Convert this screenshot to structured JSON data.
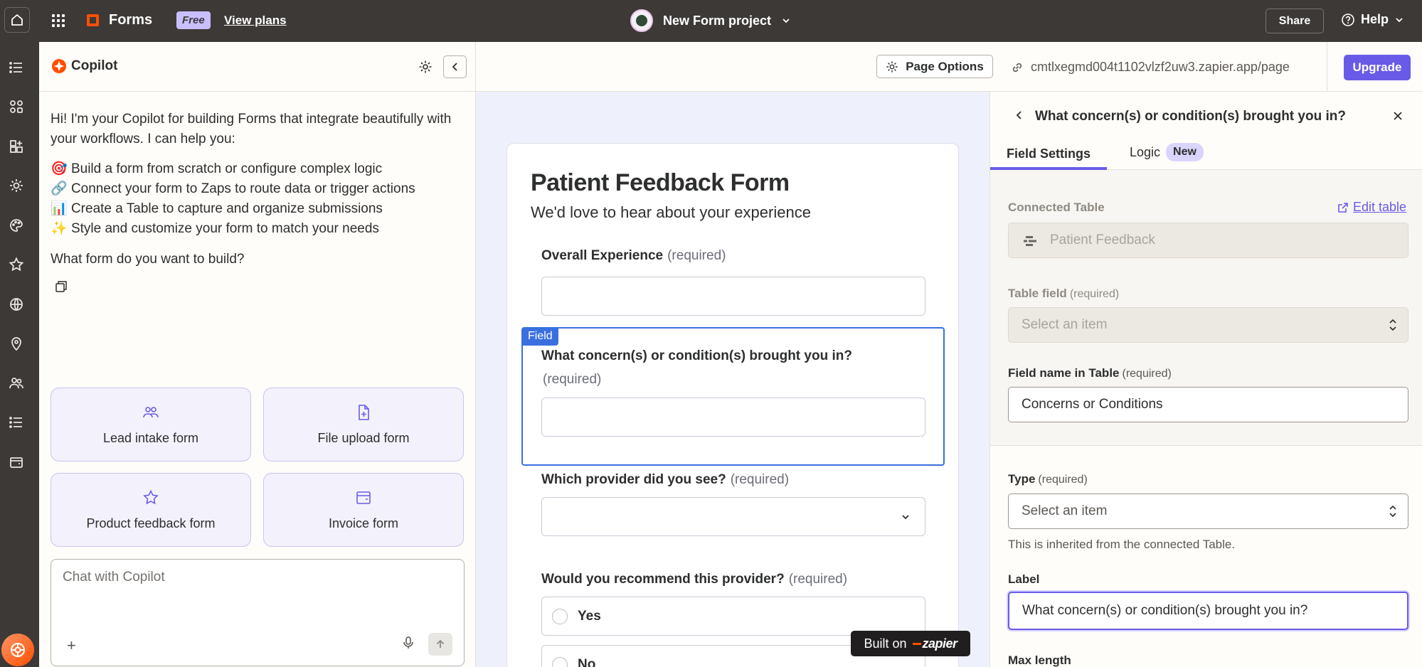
{
  "topbar": {
    "app_name": "Forms",
    "plan_badge": "Free",
    "view_plans": "View plans",
    "project_name": "New Form project",
    "share": "Share",
    "help": "Help"
  },
  "copilot": {
    "title": "Copilot",
    "intro": "Hi! I'm your Copilot for building Forms that integrate beautifully with your workflows. I can help you:",
    "bullets": [
      {
        "emoji": "🎯",
        "text": "Build a form from scratch or configure complex logic"
      },
      {
        "emoji": "🔗",
        "text": "Connect your form to Zaps to route data or trigger actions"
      },
      {
        "emoji": "📊",
        "text": "Create a Table to capture and organize submissions"
      },
      {
        "emoji": "✨",
        "text": "Style and customize your form to match your needs"
      }
    ],
    "question": "What form do you want to build?",
    "suggestions": [
      {
        "label": "Lead intake form",
        "icon": "users-icon"
      },
      {
        "label": "File upload form",
        "icon": "file-plus-icon"
      },
      {
        "label": "Product feedback form",
        "icon": "star-icon"
      },
      {
        "label": "Invoice form",
        "icon": "wallet-icon"
      }
    ],
    "chat_placeholder": "Chat with Copilot"
  },
  "optbar": {
    "page_options": "Page Options",
    "url": "cmtlxegmd004t1102vlzf2uw3.zapier.app/page",
    "upgrade": "Upgrade"
  },
  "form": {
    "title": "Patient Feedback Form",
    "subtitle": "We'd love to hear about your experience",
    "required_text": "(required)",
    "field_tag": "Field",
    "questions": [
      {
        "label": "Overall Experience",
        "type": "text"
      },
      {
        "label": "What concern(s) or condition(s) brought you in?",
        "type": "text"
      },
      {
        "label": "Which provider did you see?",
        "type": "dropdown"
      },
      {
        "label": "Would you recommend this provider?",
        "type": "radio",
        "options": [
          "Yes",
          "No"
        ]
      }
    ],
    "built_on": "Built on",
    "built_on_brand": "zapier"
  },
  "settings": {
    "title": "What concern(s) or condition(s) brought you in?",
    "tabs": [
      {
        "label": "Field Settings",
        "active": true
      },
      {
        "label": "Logic",
        "badge": "New",
        "active": false
      }
    ],
    "connected_table_label": "Connected Table",
    "edit_table": "Edit table",
    "connected_table_value": "Patient Feedback",
    "table_field_label": "Table field",
    "table_field_placeholder": "Select an item",
    "field_name_label": "Field name in Table",
    "field_name_value": "Concerns or Conditions",
    "type_label": "Type",
    "type_placeholder": "Select an item",
    "type_helper": "This is inherited from the connected Table.",
    "label_label": "Label",
    "label_value": "What concern(s) or condition(s) brought you in?",
    "max_length_label": "Max length",
    "required_text": "(required)"
  },
  "colors": {
    "topbar": "#3d3937",
    "accent": "#695be8",
    "brand": "#ff4f00",
    "selected_field": "#3b6fe0"
  }
}
